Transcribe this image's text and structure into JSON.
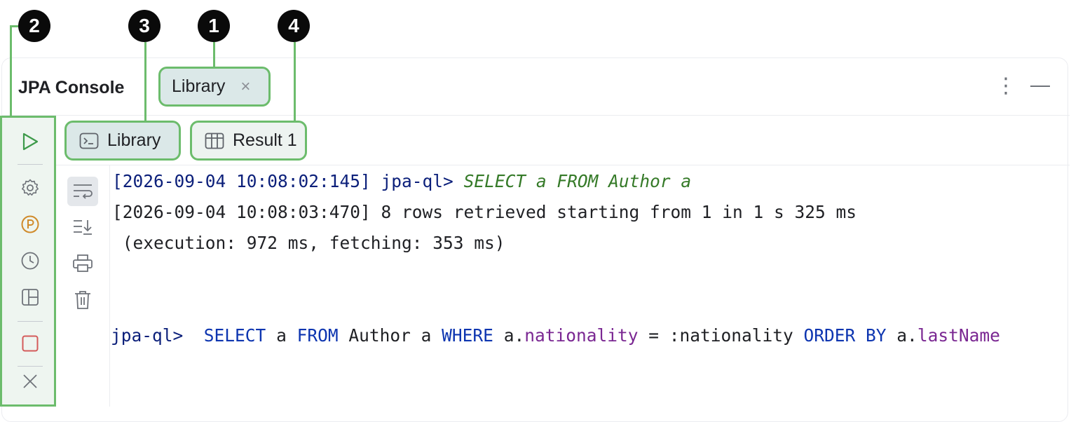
{
  "panel": {
    "title": "JPA Console",
    "tab": {
      "label": "Library",
      "close": "×"
    },
    "menu_glyph": "⋮"
  },
  "subtabs": [
    {
      "label": "Library",
      "icon": "console-icon"
    },
    {
      "label": "Result 1",
      "icon": "table-icon"
    }
  ],
  "left_toolbar": [
    "run-icon",
    "gear-icon",
    "parameters-icon",
    "history-icon",
    "layout-icon",
    "stop-icon",
    "close-icon"
  ],
  "gutter_toolbar": [
    "soft-wrap-icon",
    "scroll-to-end-icon",
    "print-icon",
    "trash-icon"
  ],
  "console": {
    "line1": {
      "timestamp": "[2026-09-04 10:08:02:145]",
      "prompt": "jpa-ql>",
      "query": "SELECT a FROM Author a"
    },
    "line2": "[2026-09-04 10:08:03:470] 8 rows retrieved starting from 1 in 1 s 325 ms",
    "line3": " (execution: 972 ms, fetching: 353 ms)",
    "input": {
      "prompt": "jpa-ql>",
      "tokens": [
        {
          "t": "SELECT",
          "c": "kw"
        },
        {
          "t": "a",
          "c": "dark"
        },
        {
          "t": "FROM",
          "c": "kw"
        },
        {
          "t": "Author a",
          "c": "dark"
        },
        {
          "t": "WHERE",
          "c": "kw"
        },
        {
          "t": "a.",
          "c": "dark"
        },
        {
          "t": "nationality",
          "c": "prop"
        },
        {
          "t": "= :nationality",
          "c": "dark"
        },
        {
          "t": "ORDER BY",
          "c": "kw"
        },
        {
          "t": "a.",
          "c": "dark"
        },
        {
          "t": "lastName",
          "c": "prop"
        }
      ]
    }
  },
  "callouts": [
    "1",
    "2",
    "3",
    "4"
  ],
  "colors": {
    "highlight": "#6cbc6c",
    "keyword": "#0d35b0",
    "property": "#7a2792",
    "prompt": "#0b1f7a",
    "query": "#357a28"
  }
}
